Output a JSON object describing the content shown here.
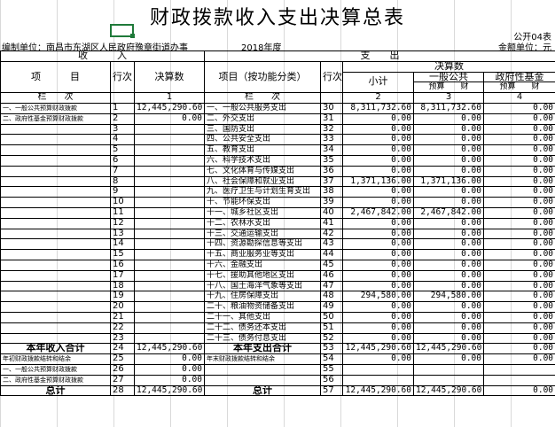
{
  "title": "财政拨款收入支出决算总表",
  "form_code": "公开04表",
  "unit_label": "编制单位：南昌市东湖区人民政府豫章街道办事",
  "year": "2018年度",
  "currency_label": "金额单位：元",
  "headers": {
    "income_section": "收　　　入",
    "expense_section": "支　　出",
    "item": "项　　　目",
    "line_no": "行次",
    "final_amount": "决算数",
    "func_item": "项目（按功能分类）",
    "line_no2": "行次",
    "final_amount2": "决算数",
    "subtotal": "小计",
    "general_public": "一般公共",
    "gov_fund": "政府性基金",
    "budget_fin": "预算　　财",
    "budget_fin2": "预算　　财",
    "col_label": "栏　　次",
    "col1": "1",
    "col_label2": "栏　　次",
    "col2": "2",
    "col3": "3",
    "col4": "4"
  },
  "rows": [
    {
      "left": "一、一般公共预算财政拨款",
      "ln": "1",
      "amt": "12,445,290.60",
      "right": "一、一般公共服务支出",
      "rn": "30",
      "sub": "8,311,732.60",
      "gp": "8,311,732.60",
      "gf": "0.00"
    },
    {
      "left": "二、政府性基金预算财政拨款",
      "ln": "2",
      "amt": "0.00",
      "right": "二、外交支出",
      "rn": "31",
      "sub": "0.00",
      "gp": "0.00",
      "gf": "0.00"
    },
    {
      "left": "",
      "ln": "3",
      "amt": "",
      "right": "三、国防支出",
      "rn": "32",
      "sub": "0.00",
      "gp": "0.00",
      "gf": "0.00"
    },
    {
      "left": "",
      "ln": "4",
      "amt": "",
      "right": "四、公共安全支出",
      "rn": "33",
      "sub": "0.00",
      "gp": "0.00",
      "gf": "0.00"
    },
    {
      "left": "",
      "ln": "5",
      "amt": "",
      "right": "五、教育支出",
      "rn": "34",
      "sub": "0.00",
      "gp": "0.00",
      "gf": "0.00"
    },
    {
      "left": "",
      "ln": "6",
      "amt": "",
      "right": "六、科学技术支出",
      "rn": "35",
      "sub": "0.00",
      "gp": "0.00",
      "gf": "0.00"
    },
    {
      "left": "",
      "ln": "7",
      "amt": "",
      "right": "七、文化体育与传媒支出",
      "rn": "36",
      "sub": "0.00",
      "gp": "0.00",
      "gf": "0.00"
    },
    {
      "left": "",
      "ln": "8",
      "amt": "",
      "right": "八、社会保障和就业支出",
      "rn": "37",
      "sub": "1,371,136.00",
      "gp": "1,371,136.00",
      "gf": "0.00"
    },
    {
      "left": "",
      "ln": "9",
      "amt": "",
      "right": "九、医疗卫生与计划生育支出",
      "rn": "38",
      "sub": "0.00",
      "gp": "0.00",
      "gf": "0.00"
    },
    {
      "left": "",
      "ln": "10",
      "amt": "",
      "right": "十、节能环保支出",
      "rn": "39",
      "sub": "0.00",
      "gp": "0.00",
      "gf": "0.00"
    },
    {
      "left": "",
      "ln": "11",
      "amt": "",
      "right": "十一、城乡社区支出",
      "rn": "40",
      "sub": "2,467,842.00",
      "gp": "2,467,842.00",
      "gf": "0.00"
    },
    {
      "left": "",
      "ln": "12",
      "amt": "",
      "right": "十二、农林水支出",
      "rn": "41",
      "sub": "0.00",
      "gp": "0.00",
      "gf": "0.00"
    },
    {
      "left": "",
      "ln": "13",
      "amt": "",
      "right": "十三、交通运输支出",
      "rn": "42",
      "sub": "0.00",
      "gp": "0.00",
      "gf": "0.00"
    },
    {
      "left": "",
      "ln": "14",
      "amt": "",
      "right": "十四、资源勘探信息等支出",
      "rn": "43",
      "sub": "0.00",
      "gp": "0.00",
      "gf": "0.00"
    },
    {
      "left": "",
      "ln": "15",
      "amt": "",
      "right": "十五、商业服务业等支出",
      "rn": "44",
      "sub": "0.00",
      "gp": "0.00",
      "gf": "0.00"
    },
    {
      "left": "",
      "ln": "16",
      "amt": "",
      "right": "十六、金融支出",
      "rn": "45",
      "sub": "0.00",
      "gp": "0.00",
      "gf": "0.00"
    },
    {
      "left": "",
      "ln": "17",
      "amt": "",
      "right": "十七、援助其他地区支出",
      "rn": "46",
      "sub": "0.00",
      "gp": "0.00",
      "gf": "0.00"
    },
    {
      "left": "",
      "ln": "18",
      "amt": "",
      "right": "十八、国土海洋气象等支出",
      "rn": "47",
      "sub": "0.00",
      "gp": "0.00",
      "gf": "0.00"
    },
    {
      "left": "",
      "ln": "19",
      "amt": "",
      "right": "十九、住房保障支出",
      "rn": "48",
      "sub": "294,580.00",
      "gp": "294,580.00",
      "gf": "0.00"
    },
    {
      "left": "",
      "ln": "20",
      "amt": "",
      "right": "二十、粮油物资储备支出",
      "rn": "49",
      "sub": "0.00",
      "gp": "0.00",
      "gf": "0.00"
    },
    {
      "left": "",
      "ln": "21",
      "amt": "",
      "right": "二十一、其他支出",
      "rn": "50",
      "sub": "0.00",
      "gp": "0.00",
      "gf": "0.00"
    },
    {
      "left": "",
      "ln": "22",
      "amt": "",
      "right": "二十二、债务还本支出",
      "rn": "51",
      "sub": "0.00",
      "gp": "0.00",
      "gf": "0.00"
    },
    {
      "left": "",
      "ln": "23",
      "amt": "",
      "right": "二十三、债务付息支出",
      "rn": "52",
      "sub": "0.00",
      "gp": "0.00",
      "gf": "0.00"
    }
  ],
  "totals": {
    "income_total_label": "本年收入合计",
    "income_total_ln": "24",
    "income_total_amt": "12,445,290.60",
    "expense_total_label": "本年支出合计",
    "expense_total_rn": "53",
    "expense_total_sub": "12,445,290.60",
    "expense_total_gp": "12,445,290.60",
    "expense_total_gf": "0.00",
    "carry_in_label": "年初财政拨款结转和结余",
    "carry_in_ln": "25",
    "carry_in_amt": "0.00",
    "carry_out_label": "年末财政拨款结转和结余",
    "carry_out_rn": "54",
    "carry_out_sub": "0.00",
    "carry_out_gp": "0.00",
    "carry_out_gf": "0.00",
    "ci1_label": "一、一般公共预算财政拨款",
    "ci1_ln": "26",
    "ci1_amt": "0.00",
    "ci1_rn": "55",
    "ci2_label": "二、政府性基金预算财政拨款",
    "ci2_ln": "27",
    "ci2_amt": "0.00",
    "ci2_rn": "56",
    "grand_left_label": "总计",
    "grand_ln": "28",
    "grand_amt": "12,445,290.60",
    "grand_right_label": "总计",
    "grand_rn": "57",
    "grand_sub": "12,445,290.60",
    "grand_gp": "12,445,290.60",
    "grand_gf": "0.00"
  }
}
